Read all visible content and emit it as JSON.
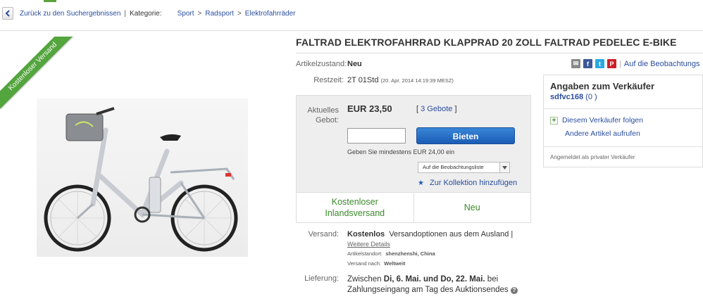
{
  "breadcrumb": {
    "back_label": "Zurück zu den Suchergebnissen",
    "kategorie_label": "Kategorie:",
    "path": [
      "Sport",
      "Radsport",
      "Elektrofahrräder"
    ],
    "sep": ">"
  },
  "image": {
    "ribbon": "Kostenloser Versand"
  },
  "listing": {
    "title": "FALTRAD ELEKTROFAHRRAD KLAPPRAD 20 ZOLL FALTRAD PEDELEC E-BIKE",
    "condition_label": "Artikelzustand:",
    "condition_value": "Neu",
    "time_label": "Restzeit:",
    "time_value": "2T 01Std",
    "time_detail": "(20. Apr. 2014   14:19:39 MESZ)"
  },
  "share": {
    "watch_link": "Auf die Beobachtungs"
  },
  "bid": {
    "current_label_1": "Aktuelles",
    "current_label_2": "Gebot:",
    "price": "EUR 23,50",
    "bids_open": "[",
    "bids_link": "3 Gebote",
    "bids_close": "]",
    "input_value": "",
    "bid_button": "Bieten",
    "min_hint": "Geben Sie mindestens EUR 24,00 ein",
    "watchlist_select": "Auf die Beobachtungsliste",
    "collection_link": "Zur Kollektion hinzufügen",
    "shipping_badge_1": "Kostenloser",
    "shipping_badge_2": "Inlandsversand",
    "condition_badge": "Neu"
  },
  "shipping": {
    "label": "Versand:",
    "value_bold": "Kostenlos",
    "value_rest": "Versandoptionen aus dem Ausland |",
    "details_link": "Weitere Details",
    "location_label": "Artikelstandort:",
    "location_value": "shenzhenshi, China",
    "ships_to_label": "Versand nach:",
    "ships_to_value": "Weltweit"
  },
  "delivery": {
    "label": "Lieferung:",
    "text_1": "Zwischen",
    "date_1": "Di, 6. Mai.",
    "und": "und",
    "date_2": "Do, 22. Mai.",
    "bei": "bei",
    "line_2": "Zahlungseingang am Tag des Auktionsendes"
  },
  "seller": {
    "header": "Angaben zum Verkäufer",
    "name": "sdfvc168",
    "score": "(0 )",
    "follow": "Diesem Verkäufer folgen",
    "other_items": "Andere Artikel aufrufen",
    "registered_as": "Angemeldet als privater Verkäufer"
  },
  "colors": {
    "accent_blue": "#2a4d9f",
    "button_blue": "#1a5cb5",
    "green": "#3a8a2a",
    "ribbon_green": "#53a53d"
  }
}
